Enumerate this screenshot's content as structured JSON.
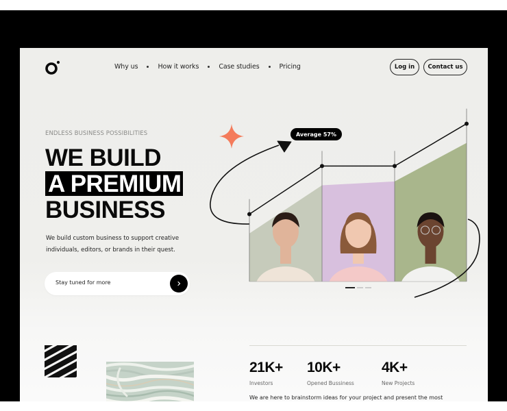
{
  "brand": {
    "logo_icon": "ring-with-dot-logo"
  },
  "nav": {
    "items": [
      {
        "label": "Why us"
      },
      {
        "label": "How it works"
      },
      {
        "label": "Case studies"
      },
      {
        "label": "Pricing"
      }
    ],
    "login_label": "Log in",
    "contact_label": "Contact us"
  },
  "hero": {
    "eyebrow": "ENDLESS BUSINESS POSSIBILITIES",
    "headline_line1": "WE BUILD",
    "headline_line2": "A PREMIUM",
    "headline_line3": "BUSINESS",
    "description": "We build custom business to support creative individuals, editors, or brands in their quest.",
    "cta_placeholder": "Stay tuned for more",
    "cta_button_icon": "chevron-right-icon"
  },
  "visual": {
    "badge_label": "Average 57%",
    "accent_color": "#f47b5b",
    "panel_colors": [
      "#c6cbbb",
      "#d8c0de",
      "#a9b68c"
    ],
    "line_values": [
      0.35,
      0.6,
      0.6,
      0.82
    ],
    "area_values": [
      0.25,
      0.5,
      0.52,
      0.72
    ],
    "panels": [
      {
        "subject": "woman-dark-hair-portrait"
      },
      {
        "subject": "woman-pink-top-portrait"
      },
      {
        "subject": "man-glasses-white-sweater-portrait"
      }
    ],
    "carousel": {
      "count": 3,
      "active": 0
    }
  },
  "stats": [
    {
      "value": "21K+",
      "label": "Investors"
    },
    {
      "value": "10K+",
      "label": "Opened Bussiness"
    },
    {
      "value": "4K+",
      "label": "New Projects"
    }
  ],
  "about": {
    "text": "We are here to brainstorm ideas for your project and present the most"
  }
}
